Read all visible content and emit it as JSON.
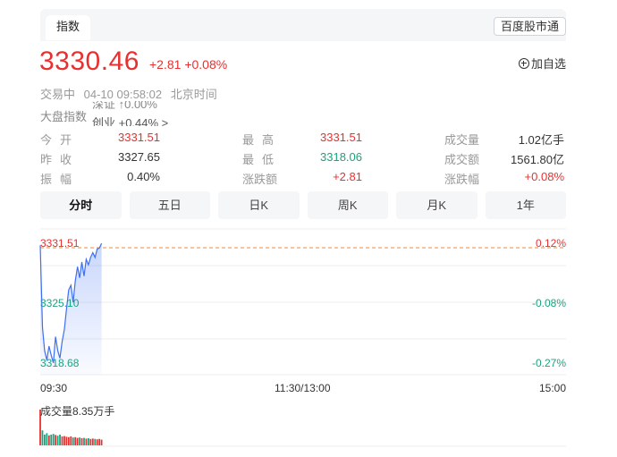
{
  "header": {
    "tab_label": "指数",
    "market_button": "百度股市通"
  },
  "quote": {
    "price": "3330.46",
    "change": "+2.81 +0.08%",
    "add_watch": "加自选"
  },
  "status": {
    "state": "交易中",
    "time": "04-10 09:58:02",
    "zone": "北京时间"
  },
  "ticker": {
    "label": "大盘指数",
    "top_text": "深证 ↑0.00%",
    "main_text": "创业 +0.44% >"
  },
  "stats": [
    [
      {
        "label": "今开",
        "value": "3331.51",
        "color": "red"
      },
      {
        "label": "最高",
        "value": "3331.51",
        "color": "red"
      },
      {
        "label": "成交量",
        "value": "1.02亿手",
        "color": "normal"
      }
    ],
    [
      {
        "label": "昨收",
        "value": "3327.65",
        "color": "normal"
      },
      {
        "label": "最低",
        "value": "3318.06",
        "color": "green"
      },
      {
        "label": "成交额",
        "value": "1561.80亿",
        "color": "normal"
      }
    ],
    [
      {
        "label": "振幅",
        "value": "0.40%",
        "color": "normal"
      },
      {
        "label": "涨跌额",
        "value": "+2.81",
        "color": "red"
      },
      {
        "label": "涨跌幅",
        "value": "+0.08%",
        "color": "red"
      }
    ]
  ],
  "period_tabs": [
    "分时",
    "五日",
    "日K",
    "周K",
    "月K",
    "1年"
  ],
  "chart": {
    "y_left": [
      "3331.51",
      "3325.10",
      "3318.68"
    ],
    "y_right": [
      "0.12%",
      "-0.08%",
      "-0.27%"
    ],
    "x_labels": [
      "09:30",
      "11:30/13:00",
      "15:00"
    ],
    "volume_label": "成交量8.35万手"
  },
  "chart_data": {
    "type": "line",
    "ylim": [
      3318.68,
      3331.51
    ],
    "prev_close": 3327.65,
    "x": [
      "09:30",
      "09:31",
      "09:32",
      "09:33",
      "09:34",
      "09:35",
      "09:36",
      "09:37",
      "09:38",
      "09:39",
      "09:40",
      "09:41",
      "09:42",
      "09:43",
      "09:44",
      "09:45",
      "09:46",
      "09:47",
      "09:48",
      "09:49",
      "09:50",
      "09:51",
      "09:52",
      "09:53",
      "09:54",
      "09:55",
      "09:56",
      "09:57",
      "09:58"
    ],
    "series": [
      {
        "values": [
          3331.3,
          3322.5,
          3320.0,
          3319.0,
          3320.5,
          3319.5,
          3318.7,
          3321.5,
          3320.0,
          3319.2,
          3321.0,
          3322.3,
          3324.5,
          3326.5,
          3327.0,
          3325.2,
          3327.5,
          3329.0,
          3327.8,
          3329.5,
          3328.0,
          3329.8,
          3329.2,
          3330.0,
          3330.5,
          3330.0,
          3330.9,
          3331.0,
          3331.5
        ]
      },
      {
        "name": "成交量",
        "values": [
          1.0,
          0.42,
          0.3,
          0.34,
          0.28,
          0.3,
          0.32,
          0.29,
          0.27,
          0.3,
          0.25,
          0.26,
          0.24,
          0.23,
          0.25,
          0.22,
          0.23,
          0.21,
          0.22,
          0.2,
          0.21,
          0.19,
          0.2,
          0.18,
          0.19,
          0.18,
          0.17,
          0.18,
          0.16
        ]
      }
    ]
  },
  "colors": {
    "up": "#e93030",
    "down": "#1aa37f",
    "line": "#3e6ff2"
  }
}
